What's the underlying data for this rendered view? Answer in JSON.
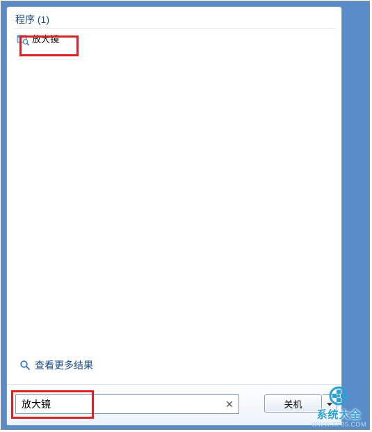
{
  "group": {
    "title": "程序 (1)"
  },
  "results": {
    "item0": {
      "label": "放大镜"
    }
  },
  "see_more": {
    "label": "查看更多结果"
  },
  "search": {
    "value": "放大镜",
    "clear_glyph": "✕"
  },
  "shutdown": {
    "label": "关机"
  },
  "watermark": {
    "brand": "系统大全",
    "url": "WWW.XP85.COM"
  }
}
